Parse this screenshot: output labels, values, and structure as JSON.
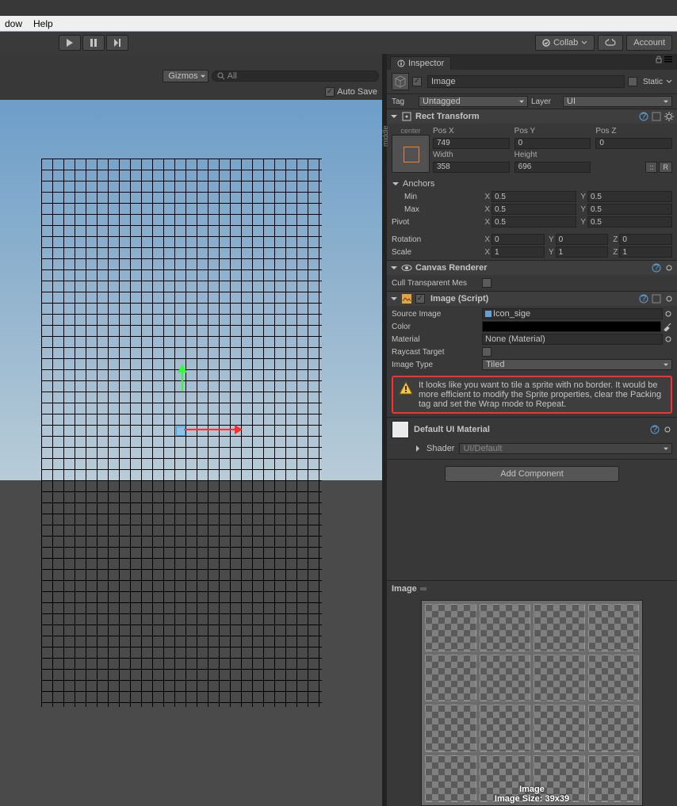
{
  "menubar": {
    "window": "dow",
    "help": "Help"
  },
  "toolbar": {
    "collab": "Collab",
    "account": "Account"
  },
  "sceneBar": {
    "gizmos": "Gizmos",
    "search_placeholder": "All",
    "autosave": "Auto Save"
  },
  "inspectorTab": "Inspector",
  "go": {
    "name": "Image",
    "enabled": true,
    "static_label": "Static",
    "tag_label": "Tag",
    "tag_value": "Untagged",
    "layer_label": "Layer",
    "layer_value": "UI"
  },
  "rect": {
    "title": "Rect Transform",
    "anchor_pos": "center",
    "anchor_side": "middle",
    "col_pos_x": "Pos X",
    "col_pos_y": "Pos Y",
    "col_pos_z": "Pos Z",
    "pos_x": "749",
    "pos_y": "0",
    "pos_z": "0",
    "col_w": "Width",
    "col_h": "Height",
    "w": "358",
    "h": "696",
    "grid_btn": "::",
    "r_btn": "R",
    "anchors": "Anchors",
    "min": "Min",
    "max": "Max",
    "pivot": "Pivot",
    "rotation": "Rotation",
    "scale": "Scale",
    "min_x": "0.5",
    "min_y": "0.5",
    "max_x": "0.5",
    "max_y": "0.5",
    "piv_x": "0.5",
    "piv_y": "0.5",
    "rot_x": "0",
    "rot_y": "0",
    "rot_z": "0",
    "scl_x": "1",
    "scl_y": "1",
    "scl_z": "1",
    "X": "X",
    "Y": "Y",
    "Z": "Z"
  },
  "canvasRenderer": {
    "title": "Canvas Renderer",
    "cull": "Cull Transparent Mes"
  },
  "image": {
    "title": "Image (Script)",
    "source": "Source Image",
    "source_val": "Icon_sige",
    "color": "Color",
    "material": "Material",
    "material_val": "None (Material)",
    "raycast": "Raycast Target",
    "type": "Image Type",
    "type_val": "Tiled",
    "warning": "It looks like you want to tile a sprite with no border. It would be more efficient to modify the Sprite properties, clear the Packing tag and set the Wrap mode to Repeat."
  },
  "material": {
    "title": "Default UI Material",
    "shader_label": "Shader",
    "shader_val": "UI/Default"
  },
  "addComp": "Add Component",
  "preview": {
    "title": "Image",
    "caption1": "Image",
    "caption2": "Image Size: 39x39"
  }
}
